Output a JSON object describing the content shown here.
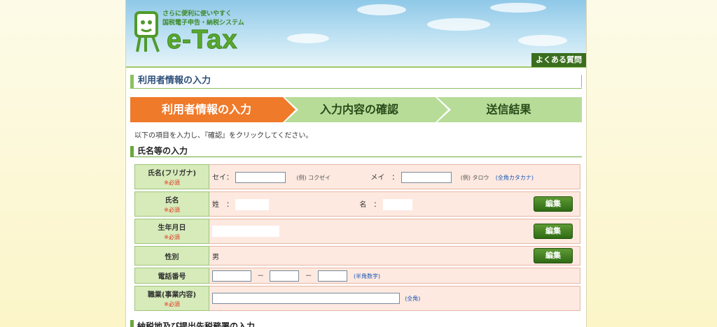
{
  "header": {
    "tagline_line1": "さらに便利に使いやすく",
    "tagline_line2": "国税電子申告・納税システム",
    "logo_text": "e-Tax",
    "faq_link": "よくある質問"
  },
  "page_title": "利用者情報の入力",
  "steps": [
    {
      "label": "利用者情報の入力",
      "active": true
    },
    {
      "label": "入力内容の確認",
      "active": false
    },
    {
      "label": "送信結果",
      "active": false
    }
  ],
  "instruction": "以下の項目を入力し、『確認』をクリックしてください。",
  "section_name": "氏名等の入力",
  "required_mark": "※必須",
  "rows": {
    "furigana": {
      "label": "氏名(フリガナ)",
      "sei_label": "セイ：",
      "sei_example": "(例) コクゼイ",
      "mei_label": "メイ　：",
      "mei_example": "(例) タロウ",
      "note": "(全角カタカナ)"
    },
    "name": {
      "label": "氏名",
      "sei_label": "姓　：",
      "mei_label": "名　：",
      "edit": "編集"
    },
    "birthdate": {
      "label": "生年月日",
      "edit": "編集"
    },
    "gender": {
      "label": "性別",
      "value": "男",
      "edit": "編集"
    },
    "phone": {
      "label": "電話番号",
      "sep": "－",
      "note": "(半角数字)"
    },
    "occupation": {
      "label": "職業(事業内容)",
      "note": "(全角)"
    }
  },
  "next_section": "納税地及び提出先税務署の入力",
  "colors": {
    "active_step": "#ef7a2a",
    "inactive_step": "#b7dc98",
    "label_bg": "#d6ebb9",
    "value_bg": "#fde9e0",
    "button": "#3f7a1f",
    "required": "#e0301e"
  }
}
